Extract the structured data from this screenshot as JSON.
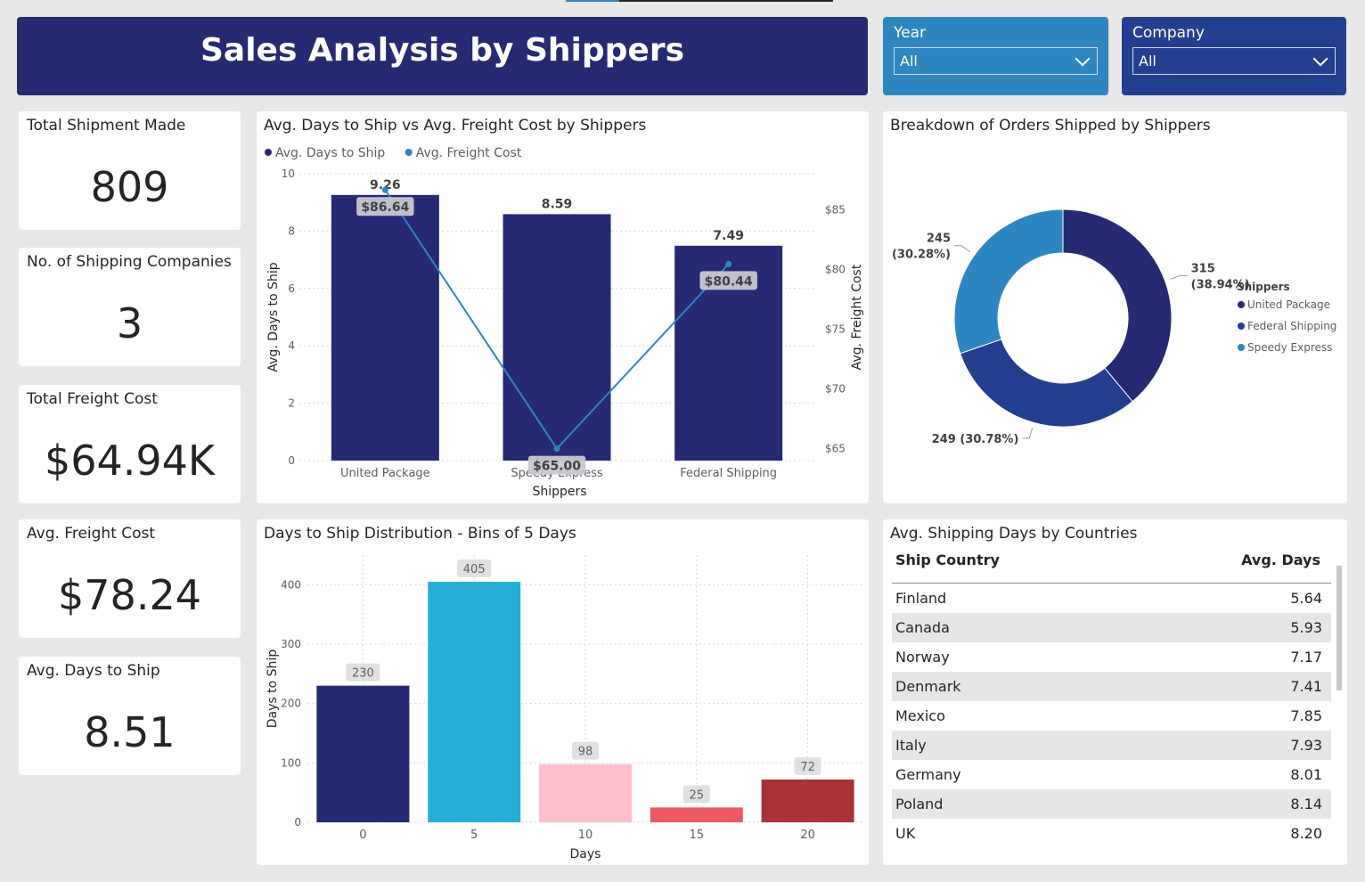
{
  "header": {
    "title": "Sales Analysis by Shippers"
  },
  "slicers": {
    "year": {
      "label": "Year",
      "value": "All",
      "bg": "#2e86c1"
    },
    "company": {
      "label": "Company",
      "value": "All",
      "bg": "#233f8f"
    }
  },
  "kpis": [
    {
      "label": "Total Shipment Made",
      "value": "809"
    },
    {
      "label": "No. of Shipping Companies",
      "value": "3"
    },
    {
      "label": "Total Freight Cost",
      "value": "$64.94K"
    },
    {
      "label": "Avg. Freight Cost",
      "value": "$78.24"
    },
    {
      "label": "Avg. Days to Ship",
      "value": "8.51"
    }
  ],
  "colors": {
    "navy": "#252a72",
    "blue": "#2e86c1",
    "mid": "#233f8f",
    "hist": [
      "#252a72",
      "#25afd6",
      "#ffc0cb",
      "#ec5b64",
      "#a83236"
    ]
  },
  "chart_data": [
    {
      "type": "bar",
      "title": "Avg. Days to Ship vs Avg. Freight Cost by Shippers",
      "xlabel": "Shippers",
      "ylabel": "Avg. Days to Ship",
      "y2label": "Avg. Freight Cost",
      "categories": [
        "United Package",
        "Speedy Express",
        "Federal Shipping"
      ],
      "series": [
        {
          "name": "Avg. Days to Ship",
          "values": [
            9.26,
            8.59,
            7.49
          ],
          "labels": [
            "9.26",
            "8.59",
            "7.49"
          ]
        },
        {
          "name": "Avg. Freight Cost",
          "values": [
            86.64,
            65.0,
            80.44
          ],
          "labels": [
            "$86.64",
            "$65.00",
            "$80.44"
          ]
        }
      ],
      "ylim": [
        0,
        10
      ],
      "yticks": [
        "0",
        "2",
        "4",
        "6",
        "8",
        "10"
      ],
      "y2lim": [
        64,
        88
      ],
      "y2ticks": [
        "$65",
        "$70",
        "$75",
        "$80",
        "$85"
      ],
      "y2tick_values": [
        65,
        70,
        75,
        80,
        85
      ],
      "grid": true,
      "legend": "top-left"
    },
    {
      "type": "pie",
      "title": "Breakdown of Orders Shipped by Shippers",
      "legend_title": "Shippers",
      "legend": "right",
      "series": [
        {
          "name": "United Package",
          "value": 315,
          "label": "315 (38.94%)"
        },
        {
          "name": "Federal Shipping",
          "value": 249,
          "label": "249 (30.78%)"
        },
        {
          "name": "Speedy Express",
          "value": 245,
          "label": "245 (30.28%)"
        }
      ]
    },
    {
      "type": "bar",
      "title": "Days to Ship Distribution - Bins of 5 Days",
      "xlabel": "Days",
      "ylabel": "Days to Ship",
      "categories": [
        "0",
        "5",
        "10",
        "15",
        "20"
      ],
      "values": [
        230,
        405,
        98,
        25,
        72
      ],
      "ylim": [
        0,
        450
      ],
      "yticks": [
        "0",
        "100",
        "200",
        "300",
        "400"
      ],
      "grid": true
    }
  ],
  "countries": {
    "title": "Avg. Shipping Days by Countries",
    "col_country": "Ship Country",
    "col_days": "Avg. Days",
    "rows": [
      {
        "country": "Finland",
        "days": "5.64"
      },
      {
        "country": "Canada",
        "days": "5.93"
      },
      {
        "country": "Norway",
        "days": "7.17"
      },
      {
        "country": "Denmark",
        "days": "7.41"
      },
      {
        "country": "Mexico",
        "days": "7.85"
      },
      {
        "country": "Italy",
        "days": "7.93"
      },
      {
        "country": "Germany",
        "days": "8.01"
      },
      {
        "country": "Poland",
        "days": "8.14"
      },
      {
        "country": "UK",
        "days": "8.20"
      }
    ]
  }
}
